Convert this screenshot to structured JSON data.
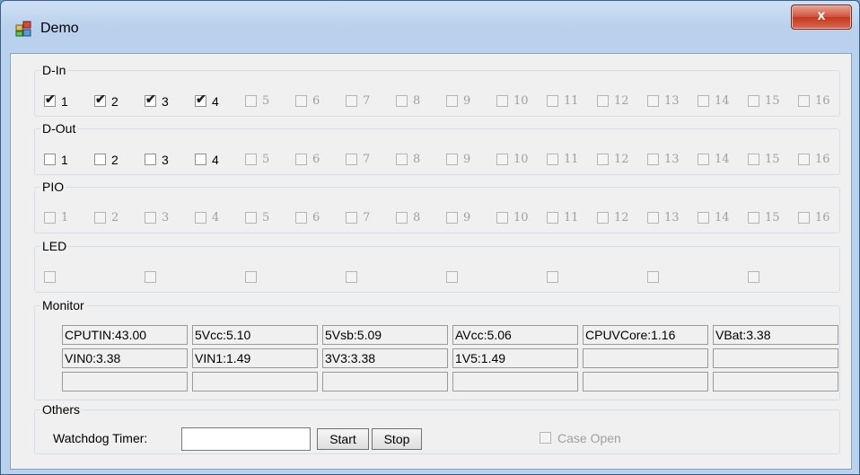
{
  "window": {
    "title": "Demo",
    "close_label": "x"
  },
  "din": {
    "legend": "D-In",
    "items": [
      {
        "label": "1",
        "checked": true,
        "enabled": true
      },
      {
        "label": "2",
        "checked": true,
        "enabled": true
      },
      {
        "label": "3",
        "checked": true,
        "enabled": true
      },
      {
        "label": "4",
        "checked": true,
        "enabled": true
      },
      {
        "label": "5",
        "checked": false,
        "enabled": false
      },
      {
        "label": "6",
        "checked": false,
        "enabled": false
      },
      {
        "label": "7",
        "checked": false,
        "enabled": false
      },
      {
        "label": "8",
        "checked": false,
        "enabled": false
      },
      {
        "label": "9",
        "checked": false,
        "enabled": false
      },
      {
        "label": "10",
        "checked": false,
        "enabled": false
      },
      {
        "label": "11",
        "checked": false,
        "enabled": false
      },
      {
        "label": "12",
        "checked": false,
        "enabled": false
      },
      {
        "label": "13",
        "checked": false,
        "enabled": false
      },
      {
        "label": "14",
        "checked": false,
        "enabled": false
      },
      {
        "label": "15",
        "checked": false,
        "enabled": false
      },
      {
        "label": "16",
        "checked": false,
        "enabled": false
      }
    ]
  },
  "dout": {
    "legend": "D-Out",
    "items": [
      {
        "label": "1",
        "checked": false,
        "enabled": true
      },
      {
        "label": "2",
        "checked": false,
        "enabled": true
      },
      {
        "label": "3",
        "checked": false,
        "enabled": true
      },
      {
        "label": "4",
        "checked": false,
        "enabled": true
      },
      {
        "label": "5",
        "checked": false,
        "enabled": false
      },
      {
        "label": "6",
        "checked": false,
        "enabled": false
      },
      {
        "label": "7",
        "checked": false,
        "enabled": false
      },
      {
        "label": "8",
        "checked": false,
        "enabled": false
      },
      {
        "label": "9",
        "checked": false,
        "enabled": false
      },
      {
        "label": "10",
        "checked": false,
        "enabled": false
      },
      {
        "label": "11",
        "checked": false,
        "enabled": false
      },
      {
        "label": "12",
        "checked": false,
        "enabled": false
      },
      {
        "label": "13",
        "checked": false,
        "enabled": false
      },
      {
        "label": "14",
        "checked": false,
        "enabled": false
      },
      {
        "label": "15",
        "checked": false,
        "enabled": false
      },
      {
        "label": "16",
        "checked": false,
        "enabled": false
      }
    ]
  },
  "pio": {
    "legend": "PIO",
    "items": [
      {
        "label": "1",
        "checked": false,
        "enabled": false
      },
      {
        "label": "2",
        "checked": false,
        "enabled": false
      },
      {
        "label": "3",
        "checked": false,
        "enabled": false
      },
      {
        "label": "4",
        "checked": false,
        "enabled": false
      },
      {
        "label": "5",
        "checked": false,
        "enabled": false
      },
      {
        "label": "6",
        "checked": false,
        "enabled": false
      },
      {
        "label": "7",
        "checked": false,
        "enabled": false
      },
      {
        "label": "8",
        "checked": false,
        "enabled": false
      },
      {
        "label": "9",
        "checked": false,
        "enabled": false
      },
      {
        "label": "10",
        "checked": false,
        "enabled": false
      },
      {
        "label": "11",
        "checked": false,
        "enabled": false
      },
      {
        "label": "12",
        "checked": false,
        "enabled": false
      },
      {
        "label": "13",
        "checked": false,
        "enabled": false
      },
      {
        "label": "14",
        "checked": false,
        "enabled": false
      },
      {
        "label": "15",
        "checked": false,
        "enabled": false
      },
      {
        "label": "16",
        "checked": false,
        "enabled": false
      }
    ]
  },
  "led": {
    "legend": "LED",
    "count": 8
  },
  "monitor": {
    "legend": "Monitor",
    "rows": [
      [
        "CPUTIN:43.00",
        "5Vcc:5.10",
        "5Vsb:5.09",
        "AVcc:5.06",
        "CPUVCore:1.16",
        "VBat:3.38"
      ],
      [
        "VIN0:3.38",
        "VIN1:1.49",
        "3V3:3.38",
        "1V5:1.49",
        "",
        ""
      ],
      [
        "",
        "",
        "",
        "",
        "",
        ""
      ]
    ]
  },
  "others": {
    "legend": "Others",
    "watchdog_label": "Watchdog Timer:",
    "watchdog_value": "",
    "start_label": "Start",
    "stop_label": "Stop",
    "case_open_label": "Case Open"
  }
}
